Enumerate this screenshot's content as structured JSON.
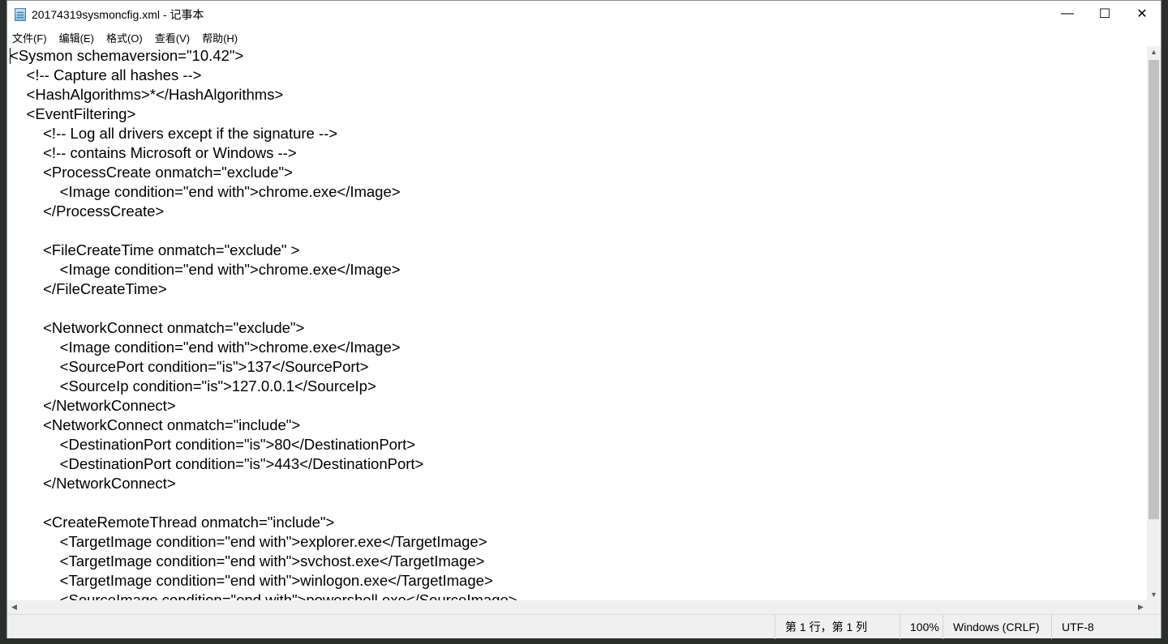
{
  "window": {
    "title": "20174319sysmoncfig.xml - 记事本",
    "controls": {
      "minimize": "—",
      "maximize": "☐",
      "close": "✕"
    }
  },
  "menu": [
    "文件(F)",
    "编辑(E)",
    "格式(O)",
    "查看(V)",
    "帮助(H)"
  ],
  "editor": {
    "lines": [
      "<Sysmon schemaversion=\"10.42\">",
      "    <!-- Capture all hashes -->",
      "    <HashAlgorithms>*</HashAlgorithms>",
      "    <EventFiltering>",
      "        <!-- Log all drivers except if the signature -->",
      "        <!-- contains Microsoft or Windows -->",
      "        <ProcessCreate onmatch=\"exclude\">",
      "            <Image condition=\"end with\">chrome.exe</Image>",
      "        </ProcessCreate>",
      "",
      "        <FileCreateTime onmatch=\"exclude\" >",
      "            <Image condition=\"end with\">chrome.exe</Image>",
      "        </FileCreateTime>",
      "",
      "        <NetworkConnect onmatch=\"exclude\">",
      "            <Image condition=\"end with\">chrome.exe</Image>",
      "            <SourcePort condition=\"is\">137</SourcePort>",
      "            <SourceIp condition=\"is\">127.0.0.1</SourceIp>",
      "        </NetworkConnect>",
      "        <NetworkConnect onmatch=\"include\">",
      "            <DestinationPort condition=\"is\">80</DestinationPort>",
      "            <DestinationPort condition=\"is\">443</DestinationPort>",
      "        </NetworkConnect>",
      "",
      "        <CreateRemoteThread onmatch=\"include\">",
      "            <TargetImage condition=\"end with\">explorer.exe</TargetImage>",
      "            <TargetImage condition=\"end with\">svchost.exe</TargetImage>",
      "            <TargetImage condition=\"end with\">winlogon.exe</TargetImage>",
      "            <SourceImage condition=\"end with\">powershell.exe</SourceImage>"
    ]
  },
  "status": {
    "position": "第 1 行，第 1 列",
    "zoom": "100%",
    "line_ending": "Windows (CRLF)",
    "encoding": "UTF-8"
  }
}
